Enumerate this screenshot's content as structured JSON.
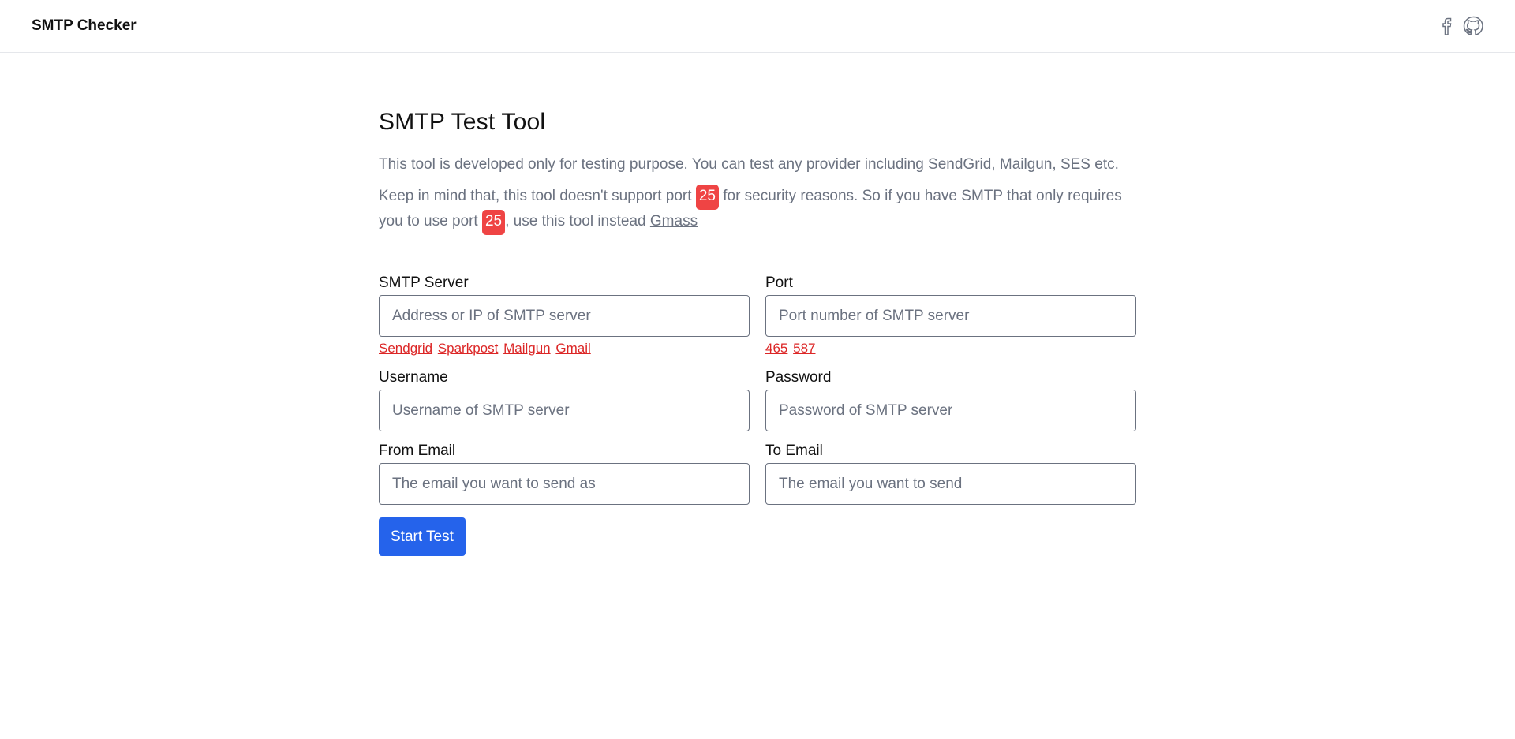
{
  "header": {
    "brand": "SMTP Checker",
    "icons": [
      "facebook-icon",
      "github-icon"
    ]
  },
  "main": {
    "title": "SMTP Test Tool",
    "intro": "This tool is developed only for testing purpose. You can test any provider including SendGrid, Mailgun, SES etc.",
    "note_part1": "Keep in mind that, this tool doesn't support port ",
    "note_port": "25",
    "note_part2": " for security reasons. So if you have SMTP that only requires you to use port ",
    "note_part3": ", use this tool instead ",
    "note_link": "Gmass"
  },
  "form": {
    "smtp_server": {
      "label": "SMTP Server",
      "placeholder": "Address or IP of SMTP server",
      "value": "",
      "presets": [
        "Sendgrid",
        "Sparkpost",
        "Mailgun",
        "Gmail"
      ]
    },
    "port": {
      "label": "Port",
      "placeholder": "Port number of SMTP server",
      "value": "",
      "presets": [
        "465",
        "587"
      ]
    },
    "username": {
      "label": "Username",
      "placeholder": "Username of SMTP server",
      "value": ""
    },
    "password": {
      "label": "Password",
      "placeholder": "Password of SMTP server",
      "value": ""
    },
    "from_email": {
      "label": "From Email",
      "placeholder": "The email you want to send as",
      "value": ""
    },
    "to_email": {
      "label": "To Email",
      "placeholder": "The email you want to send",
      "value": ""
    },
    "submit_label": "Start Test"
  },
  "colors": {
    "accent": "#2563eb",
    "badge": "#ef4444",
    "link_red": "#dc2626",
    "muted_text": "#6b7280"
  }
}
